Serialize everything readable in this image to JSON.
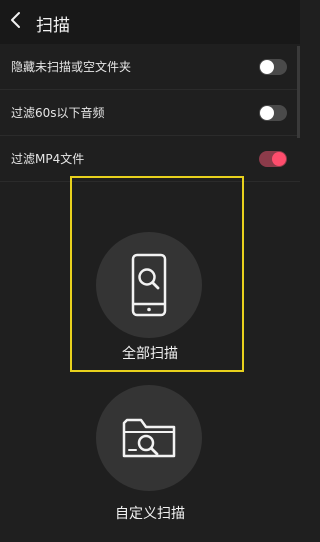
{
  "header": {
    "title": "扫描",
    "back_icon": "chevron-left-icon"
  },
  "settings": [
    {
      "label": "隐藏未扫描或空文件夹",
      "enabled": false
    },
    {
      "label": "过滤60s以下音频",
      "enabled": false
    },
    {
      "label": "过滤MP4文件",
      "enabled": true
    }
  ],
  "actions": {
    "full_scan_label": "全部扫描",
    "full_scan_icon": "phone-search-icon",
    "custom_scan_label": "自定义扫描",
    "custom_scan_icon": "folder-search-icon"
  },
  "colors": {
    "background": "#1f1f1f",
    "toggle_on": "#ff4d6d",
    "highlight": "#e8d11d"
  }
}
